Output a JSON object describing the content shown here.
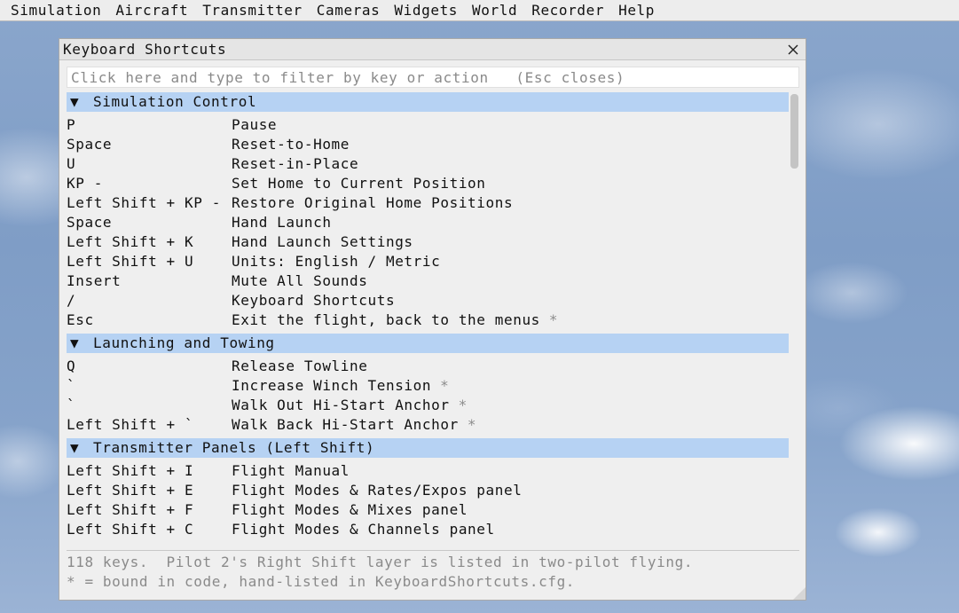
{
  "menubar": {
    "items": [
      "Simulation",
      "Aircraft",
      "Transmitter",
      "Cameras",
      "Widgets",
      "World",
      "Recorder",
      "Help"
    ]
  },
  "dialog": {
    "title": "Keyboard Shortcuts",
    "close_icon": "close-icon",
    "filter": {
      "value": "",
      "placeholder": "Click here and type to filter by key or action   (Esc closes)"
    },
    "expanded_icon": "▼",
    "sections": [
      {
        "title": "Simulation Control",
        "rows": [
          {
            "key": "P",
            "action": "Pause",
            "star": ""
          },
          {
            "key": "Space",
            "action": "Reset-to-Home",
            "star": ""
          },
          {
            "key": "U",
            "action": "Reset-in-Place",
            "star": ""
          },
          {
            "key": "KP -",
            "action": "Set Home to Current Position",
            "star": ""
          },
          {
            "key": "Left Shift + KP -",
            "action": "Restore Original Home Positions",
            "star": ""
          },
          {
            "key": "Space",
            "action": "Hand Launch",
            "star": ""
          },
          {
            "key": "Left Shift + K",
            "action": "Hand Launch Settings",
            "star": ""
          },
          {
            "key": "Left Shift + U",
            "action": "Units: English / Metric",
            "star": ""
          },
          {
            "key": "Insert",
            "action": "Mute All Sounds",
            "star": ""
          },
          {
            "key": "/",
            "action": "Keyboard Shortcuts",
            "star": ""
          },
          {
            "key": "Esc",
            "action": "Exit the flight, back to the menus",
            "star": "*"
          }
        ]
      },
      {
        "title": "Launching and Towing",
        "rows": [
          {
            "key": "Q",
            "action": "Release Towline",
            "star": ""
          },
          {
            "key": "`",
            "action": "Increase Winch Tension",
            "star": "*"
          },
          {
            "key": "`",
            "action": "Walk Out Hi-Start Anchor",
            "star": "*"
          },
          {
            "key": "Left Shift + `",
            "action": "Walk Back Hi-Start Anchor",
            "star": "*"
          }
        ]
      },
      {
        "title": "Transmitter Panels (Left Shift)",
        "rows": [
          {
            "key": "Left Shift + I",
            "action": "Flight Manual",
            "star": ""
          },
          {
            "key": "Left Shift + E",
            "action": "Flight Modes & Rates/Expos panel",
            "star": ""
          },
          {
            "key": "Left Shift + F",
            "action": "Flight Modes & Mixes panel",
            "star": ""
          },
          {
            "key": "Left Shift + C",
            "action": "Flight Modes & Channels panel",
            "star": ""
          }
        ]
      }
    ],
    "scroll_fraction": 0.0,
    "footer": {
      "line1": "118 keys.  Pilot 2's Right Shift layer is listed in two-pilot flying.",
      "line2": "* = bound in code, hand-listed in KeyboardShortcuts.cfg."
    }
  },
  "colors": {
    "section_header_bg": "#b6d2f3",
    "dialog_bg": "#efefef",
    "footer_text": "#8a8a8a"
  }
}
